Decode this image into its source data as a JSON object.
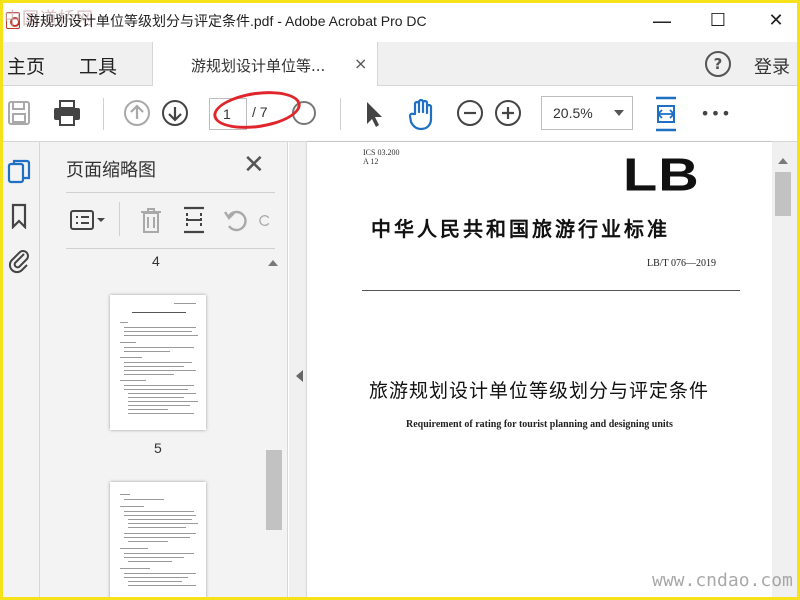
{
  "watermark_top": "中国道桥网",
  "watermark_bottom": "www.cndao.com",
  "window": {
    "title": "游规划设计单位等级划分与评定条件.pdf - Adobe Acrobat Pro DC",
    "minimize": "—",
    "maximize": "☐",
    "close": "✕"
  },
  "menu": {
    "home": "主页",
    "tools": "工具",
    "tab_label": "游规划设计单位等...",
    "tab_close": "×",
    "help": "?",
    "login": "登录"
  },
  "toolbar": {
    "page_current": "1",
    "page_total": "/ 7",
    "zoom": "20.5%",
    "more": "•••"
  },
  "panel": {
    "title": "页面缩略图",
    "close": "✕",
    "thumbnails": [
      {
        "label": "4"
      },
      {
        "label": "5"
      }
    ]
  },
  "document": {
    "ics": "ICS  03.200",
    "a_code": "A  12",
    "logo": "LB",
    "standard_heading": "中华人民共和国旅游行业标准",
    "standard_code": "LB/T  076—2019",
    "title": "旅游规划设计单位等级划分与评定条件",
    "subtitle": "Requirement of rating for tourist planning and designing units"
  },
  "colors": {
    "accent_blue": "#1f6fc5",
    "annotation_red": "#e0262b",
    "frame_yellow": "#f5e21b"
  }
}
